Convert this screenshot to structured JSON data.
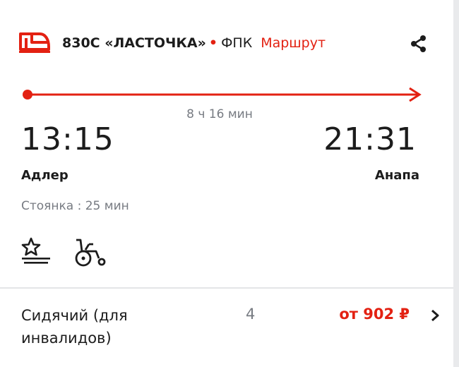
{
  "colors": {
    "accent": "#e32112",
    "muted": "#777b82",
    "text": "#1c1c1c",
    "divider": "#e4e5e7"
  },
  "header": {
    "logo_icon": "train-icon",
    "train_name": "830С «ЛАСТОЧКА»",
    "separator": "•",
    "carrier": "ФПК",
    "route_link": "Маршрут",
    "share_icon": "share-icon"
  },
  "trip": {
    "duration": "8 ч 16 мин",
    "departure_time": "13:15",
    "arrival_time": "21:31",
    "departure_station": "Адлер",
    "arrival_station": "Анапа",
    "stop": "Стоянка : 25 мин"
  },
  "amenities": [
    {
      "icon": "star-service-icon"
    },
    {
      "icon": "wheelchair-icon"
    }
  ],
  "seat_class": {
    "name": "Сидячий (для инвалидов)",
    "count": "4",
    "price": "от 902 ₽",
    "chevron_icon": "chevron-right-icon"
  }
}
